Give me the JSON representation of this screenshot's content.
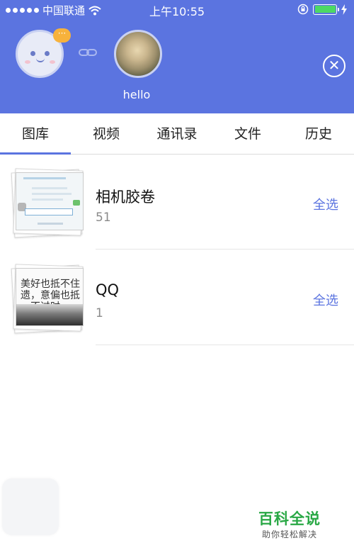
{
  "status_bar": {
    "carrier": "中国联通",
    "time": "上午10:55"
  },
  "header": {
    "bubble_text": "···",
    "peer_name": "hello",
    "close_symbol": "✕"
  },
  "tabs": [
    {
      "label": "图库",
      "active": true
    },
    {
      "label": "视频",
      "active": false
    },
    {
      "label": "通讯录",
      "active": false
    },
    {
      "label": "文件",
      "active": false
    },
    {
      "label": "历史",
      "active": false
    }
  ],
  "albums": [
    {
      "title": "相机胶卷",
      "count": "51",
      "action": "全选"
    },
    {
      "title": "QQ",
      "count": "1",
      "action": "全选",
      "thumb_text": "美好也抵不住遗，意偏也抵不过时。"
    }
  ],
  "watermark": {
    "title": "百科全说",
    "subtitle": "助你轻松解决"
  },
  "colors": {
    "accent": "#5b74e0",
    "header_bg": "#5b74e0",
    "battery": "#4cd964",
    "watermark": "#29a845"
  },
  "icons": [
    "signal-dots-icon",
    "wifi-icon",
    "rotation-lock-icon",
    "battery-icon",
    "charging-icon",
    "link-icon",
    "close-icon",
    "chat-bubble-icon"
  ]
}
